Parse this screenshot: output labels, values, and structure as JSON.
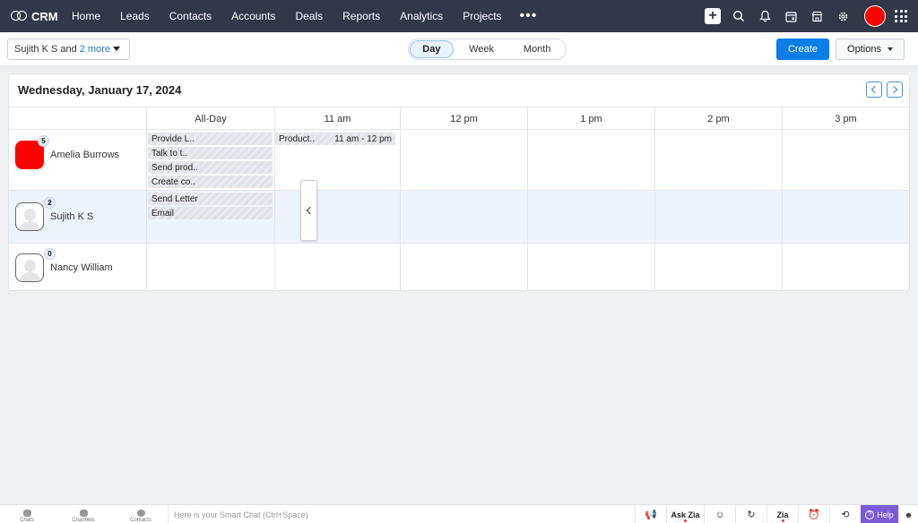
{
  "app": {
    "name": "CRM"
  },
  "nav": {
    "items": [
      "Home",
      "Leads",
      "Contacts",
      "Accounts",
      "Deals",
      "Reports",
      "Analytics",
      "Projects"
    ],
    "more_glyph": "•••",
    "right_icons": [
      "plus-icon",
      "search-icon",
      "bell-icon",
      "calendar-icon",
      "store-icon",
      "gear-icon",
      "avatar",
      "apps-grid-icon"
    ]
  },
  "toolbar": {
    "user_select_label": "Sujith K S and",
    "user_select_more": "2 more",
    "views": [
      "Day",
      "Week",
      "Month"
    ],
    "active_view": "Day",
    "create_label": "Create",
    "options_label": "Options"
  },
  "calendar": {
    "date_title": "Wednesday, January 17, 2024",
    "columns": [
      "All-Day",
      "11 am",
      "12 pm",
      "1 pm",
      "2 pm",
      "3 pm"
    ],
    "rows": [
      {
        "name": "Amelia Burrows",
        "count": "5",
        "avatar_color": "#ff0000",
        "allday": [
          "Provide L..",
          "Talk to t..",
          "Send prod..",
          "Create co.."
        ],
        "timed": [
          {
            "title": "Product..",
            "time": "11 am - 12 pm"
          }
        ]
      },
      {
        "name": "Sujith K S",
        "count": "2",
        "allday": [
          "Send Letter",
          "Email"
        ],
        "timed": []
      },
      {
        "name": "Nancy William",
        "count": "0",
        "allday": [],
        "timed": []
      }
    ]
  },
  "bottombar": {
    "left": [
      "Chats",
      "Channels",
      "Contacts"
    ],
    "smart_chat_placeholder": "Here is your Smart Chat (Ctrl+Space)",
    "ask_zia": "Ask Zia",
    "zia": "Zia",
    "help": "Help"
  },
  "colors": {
    "nav_bg": "#313949",
    "accent": "#0a7ee6",
    "help_bg": "#7b5cd6"
  }
}
